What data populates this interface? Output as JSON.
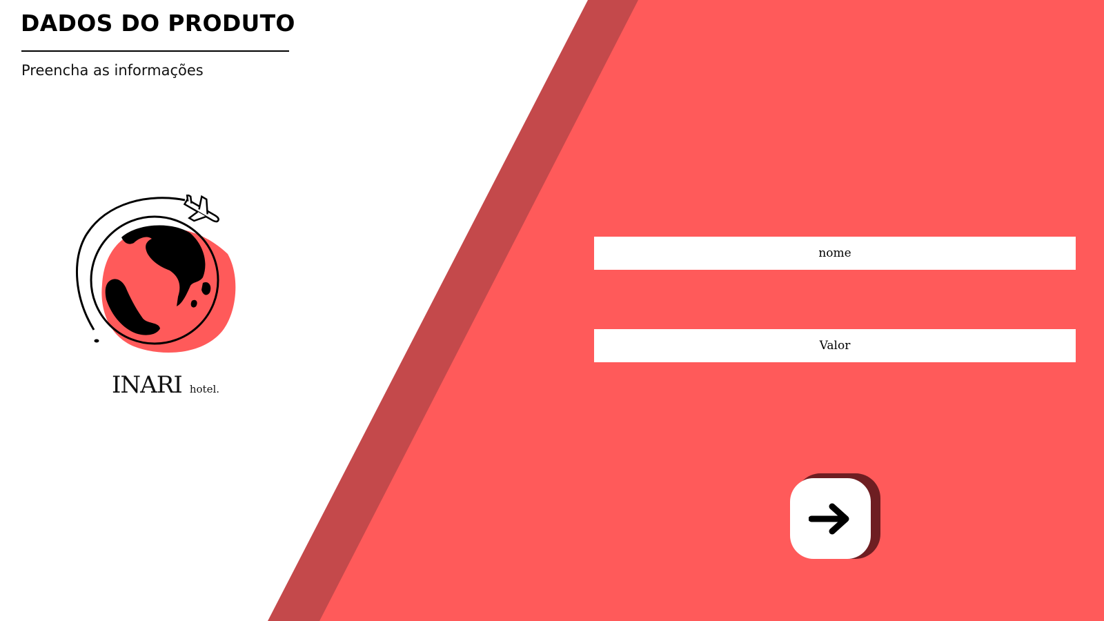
{
  "header": {
    "title": "DADOS DO PRODUTO",
    "subtitle": "Preencha as informações"
  },
  "brand": {
    "name": "INARI",
    "suffix": "hotel.",
    "logo_icon": "globe-airplane-icon"
  },
  "form": {
    "nome_placeholder": "nome",
    "valor_placeholder": "Valor"
  },
  "actions": {
    "next_icon": "arrow-right-icon"
  },
  "colors": {
    "accent": "#ff5a5a",
    "accent_dark": "#c4494b",
    "button_shadow": "#6e1e22",
    "background": "#ffffff"
  }
}
